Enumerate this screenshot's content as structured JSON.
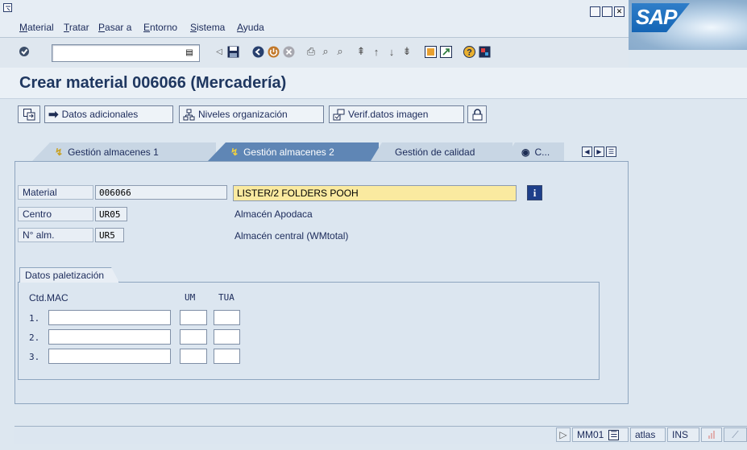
{
  "menu": {
    "items": [
      {
        "label": "Material",
        "ul": "M",
        "rest": "aterial"
      },
      {
        "label": "Tratar",
        "ul": "T",
        "rest": "ratar"
      },
      {
        "label": "Pasar a",
        "ul": "P",
        "rest": "asar a"
      },
      {
        "label": "Entorno",
        "ul": "E",
        "rest": "ntorno"
      },
      {
        "label": "Sistema",
        "ul": "S",
        "rest": "istema"
      },
      {
        "label": "Ayuda",
        "ul": "A",
        "rest": "yuda"
      }
    ]
  },
  "logo": {
    "text": "SAP"
  },
  "toolbar": {
    "command_field_value": ""
  },
  "title": "Crear material 006066 (Mercadería)",
  "app_toolbar": {
    "datos_adicionales": "Datos adicionales",
    "niveles_organizacion": "Niveles organización",
    "verif_datos_imagen": "Verif.datos imagen"
  },
  "tabs": {
    "tab1": "Gestión almacenes 1",
    "tab2": "Gestión almacenes 2",
    "tab3": "Gestión de calidad",
    "tab4": "C..."
  },
  "form": {
    "material_label": "Material",
    "material_value": "006066",
    "material_desc": "LISTER/2 FOLDERS POOH",
    "centro_label": "Centro",
    "centro_value": "UR05",
    "centro_desc": "Almacén Apodaca",
    "almacen_label": "N° alm.",
    "almacen_value": "UR5",
    "almacen_desc": "Almacén central (WMtotal)"
  },
  "palet": {
    "title": "Datos paletización",
    "col_ctd": "Ctd.MAC",
    "col_um": "UM",
    "col_tua": "TUA",
    "rows": [
      "1.",
      "2.",
      "3."
    ]
  },
  "status": {
    "transaction": "MM01",
    "server": "atlas",
    "mode": "INS"
  },
  "colors": {
    "title": "#1f3760",
    "active_tab": "#5f86b5",
    "required_field": "#faeaa0",
    "logo_blue": "#1565b5"
  }
}
